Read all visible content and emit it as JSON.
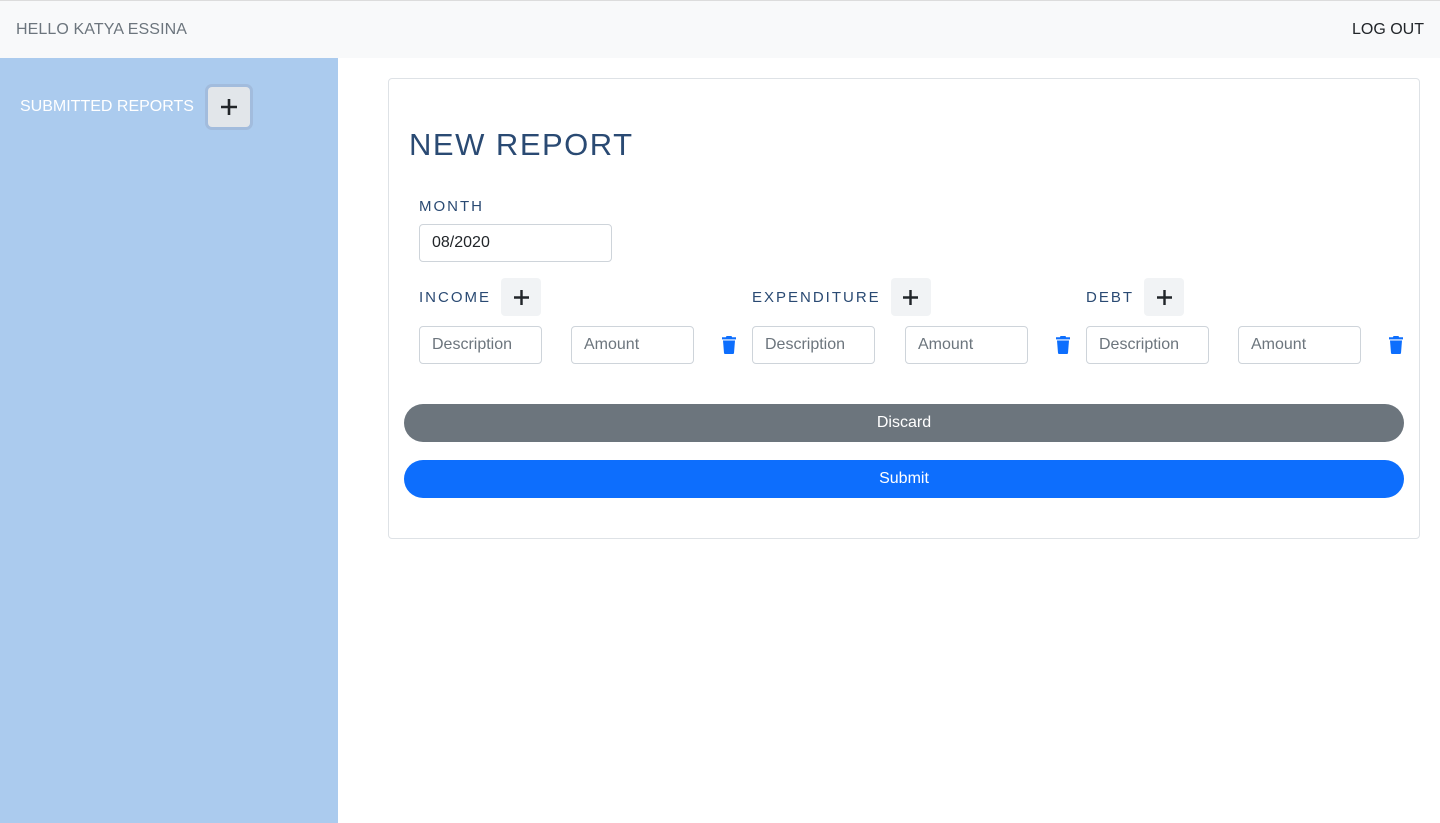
{
  "header": {
    "greeting": "HELLO KATYA ESSINA",
    "logout_label": "LOG OUT"
  },
  "sidebar": {
    "label": "SUBMITTED REPORTS",
    "add_icon": "plus-icon"
  },
  "report": {
    "title": "NEW REPORT",
    "month_label": "MONTH",
    "month_value": "08/2020",
    "sections": [
      {
        "label": "INCOME",
        "description_placeholder": "Description",
        "amount_placeholder": "Amount"
      },
      {
        "label": "EXPENDITURE",
        "description_placeholder": "Description",
        "amount_placeholder": "Amount"
      },
      {
        "label": "DEBT",
        "description_placeholder": "Description",
        "amount_placeholder": "Amount"
      }
    ],
    "discard_label": "Discard",
    "submit_label": "Submit"
  },
  "colors": {
    "sidebar_bg": "#abcbee",
    "heading": "#2a4a73",
    "primary": "#0d6efd",
    "secondary": "#6c757d"
  }
}
